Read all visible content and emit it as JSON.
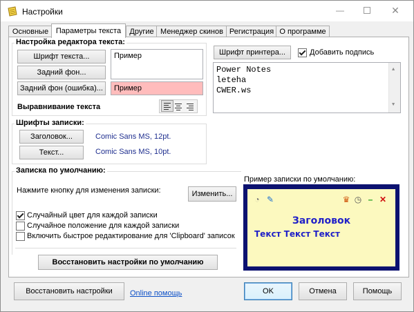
{
  "window": {
    "title": "Настройки"
  },
  "tabs": [
    {
      "label": "Основные"
    },
    {
      "label": "Параметры текста"
    },
    {
      "label": "Другие"
    },
    {
      "label": "Менеджер скинов"
    },
    {
      "label": "Регистрация"
    },
    {
      "label": "О программе"
    }
  ],
  "editor": {
    "group_title": "Настройка редактора текста:",
    "font_button": "Шрифт текста...",
    "bg_button": "Задний фон...",
    "bg_error_button": "Задний фон (ошибка)...",
    "sample_text": "Пример",
    "sample_error_text": "Пример",
    "error_bg_color": "#ffbcbc",
    "align_label": "Выравнивание текста"
  },
  "printer": {
    "font_button": "Шрифт принтера...",
    "add_signature_label": "Добавить подпись",
    "add_signature_checked": true,
    "signature_lines": [
      "Power Notes",
      "leteha",
      "CWER.ws"
    ]
  },
  "fonts": {
    "group_title": "Шрифты записки:",
    "heading_button": "Заголовок...",
    "heading_font": "Comic Sans MS,  12pt.",
    "text_button": "Текст...",
    "text_font": "Comic Sans MS,  10pt."
  },
  "default_note": {
    "group_title": "Записка по умолчанию:",
    "hint": "Нажмите кнопку для изменения записки:",
    "change_button": "Изменить...",
    "options": [
      {
        "label": "Случайный цвет для каждой записки",
        "checked": true
      },
      {
        "label": "Случайное положение для каждой записки",
        "checked": false
      },
      {
        "label": "Включить быстрое редактирование для 'Clipboard' записок",
        "checked": false
      }
    ],
    "restore_defaults_button": "Восстановить настройки по умолчанию"
  },
  "preview": {
    "label": "Пример записки по умолчанию:",
    "title": "Заголовок",
    "text": "Текст Текст Текст",
    "frame_color": "#0c1270",
    "note_color": "#fcf9bf"
  },
  "footer": {
    "restore_button": "Восстановить настройки",
    "online_help": "Online помощь",
    "ok": "OK",
    "cancel": "Отмена",
    "help": "Помощь"
  }
}
